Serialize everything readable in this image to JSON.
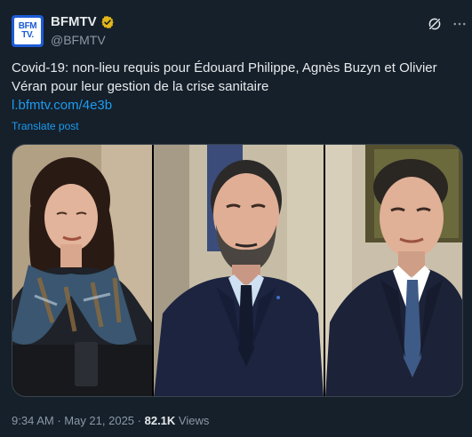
{
  "author": {
    "avatar_line1": "BFM",
    "avatar_line2": "TV.",
    "display_name": "BFMTV",
    "handle": "@BFMTV"
  },
  "post": {
    "text_line1": "Covid-19: non-lieu requis pour Édouard Philippe, Agnès Buzyn et Olivier",
    "text_line2": "Véran pour leur gestion de la crise sanitaire",
    "link": "l.bfmtv.com/4e3b",
    "translate_label": "Translate post"
  },
  "footer": {
    "time": "9:34 AM",
    "separator": " · ",
    "date": "May 21, 2025",
    "views_count": "82.1K",
    "views_label": " Views"
  },
  "icons": {
    "verified": "verified-badge-icon",
    "grok": "grok-icon",
    "more": "more-options-icon"
  },
  "colors": {
    "background": "#15202b",
    "text": "#e7e9ea",
    "muted": "#8b98a5",
    "link": "#1d9bf0",
    "verified_gold": "#e2b719",
    "avatar_blue": "#1d5bd6"
  }
}
